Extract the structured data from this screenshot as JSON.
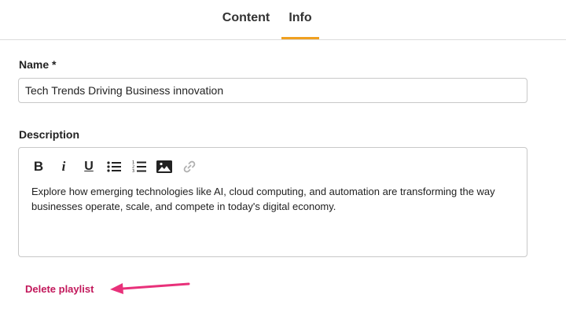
{
  "tabs": [
    {
      "label": "Content",
      "active": false
    },
    {
      "label": "Info",
      "active": true
    }
  ],
  "form": {
    "name_label": "Name *",
    "name_value": "Tech Trends Driving Business innovation",
    "description_label": "Description",
    "description_text": "Explore how emerging technologies like AI, cloud computing, and automation are transforming the way businesses operate, scale, and compete in today's digital economy.",
    "toolbar": {
      "bold": "B",
      "italic": "i",
      "underline": "U",
      "icons": [
        "bullet-list-icon",
        "numbered-list-icon",
        "image-icon",
        "link-icon"
      ]
    }
  },
  "actions": {
    "delete_label": "Delete playlist"
  },
  "colors": {
    "active_tab_underline": "#f0a020",
    "delete": "#c2185b",
    "annotation_arrow": "#e8317a",
    "disabled_icon": "#b0b0b0"
  }
}
